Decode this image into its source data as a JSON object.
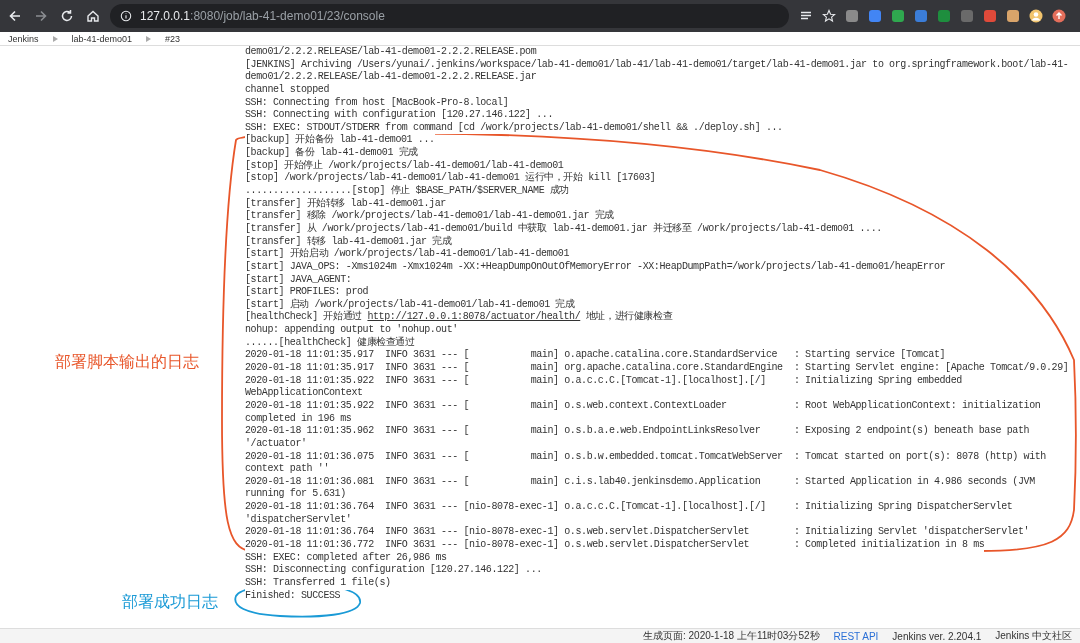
{
  "browser": {
    "url_host": "127.0.0.1",
    "url_path": ":8080/job/lab-41-demo01/23/console"
  },
  "breadcrumbs": [
    "Jenkins",
    "lab-41-demo01",
    "#23"
  ],
  "console": {
    "lines": [
      {
        "text": "demo01/2.2.2.RELEASE/lab-41-demo01-2.2.2.RELEASE.pom"
      },
      {
        "text": "[JENKINS] Archiving /Users/yunai/.jenkins/workspace/lab-41-demo01/lab-41/lab-41-demo01/target/lab-41-demo01.jar to org.springframework.boot/lab-41-"
      },
      {
        "text": "demo01/2.2.2.RELEASE/lab-41-demo01-2.2.2.RELEASE.jar"
      },
      {
        "text": "channel stopped"
      },
      {
        "text": "SSH: Connecting from host [MacBook-Pro-8.local]"
      },
      {
        "text": "SSH: Connecting with configuration [120.27.146.122] ..."
      },
      {
        "text": "SSH: EXEC: STDOUT/STDERR from command [cd /work/projects/lab-41-demo01/shell && ./deploy.sh] ..."
      },
      {
        "text": "[backup] 开始备份 lab-41-demo01 ..."
      },
      {
        "text": "[backup] 备份 lab-41-demo01 完成"
      },
      {
        "text": "[stop] 开始停止 /work/projects/lab-41-demo01/lab-41-demo01"
      },
      {
        "text": "[stop] /work/projects/lab-41-demo01/lab-41-demo01 运行中，开始 kill [17603]"
      },
      {
        "text": "...................[stop] 停止 $BASE_PATH/$SERVER_NAME 成功"
      },
      {
        "text": "[transfer] 开始转移 lab-41-demo01.jar"
      },
      {
        "text": "[transfer] 移除 /work/projects/lab-41-demo01/lab-41-demo01.jar 完成"
      },
      {
        "text": "[transfer] 从 /work/projects/lab-41-demo01/build 中获取 lab-41-demo01.jar 并迁移至 /work/projects/lab-41-demo01 ...."
      },
      {
        "text": "[transfer] 转移 lab-41-demo01.jar 完成"
      },
      {
        "text": "[start] 开始启动 /work/projects/lab-41-demo01/lab-41-demo01"
      },
      {
        "text": "[start] JAVA_OPS: -Xms1024m -Xmx1024m -XX:+HeapDumpOnOutOfMemoryError -XX:HeapDumpPath=/work/projects/lab-41-demo01/heapError"
      },
      {
        "text": "[start] JAVA_AGENT:"
      },
      {
        "text": "[start] PROFILES: prod"
      },
      {
        "text": "[start] 启动 /work/projects/lab-41-demo01/lab-41-demo01 完成"
      },
      {
        "text": "[healthCheck] 开始通过 ",
        "link": "http://127.0.0.1:8078/actuator/health/",
        "after": " 地址，进行健康检查"
      },
      {
        "text": "nohup: appending output to 'nohup.out'"
      },
      {
        "text": "......[healthCheck] 健康检查通过"
      },
      {
        "text": "2020-01-18 11:01:35.917  INFO 3631 --- [           main] o.apache.catalina.core.StandardService   : Starting service [Tomcat]"
      },
      {
        "text": "2020-01-18 11:01:35.917  INFO 3631 --- [           main] org.apache.catalina.core.StandardEngine  : Starting Servlet engine: [Apache Tomcat/9.0.29]"
      },
      {
        "text": "2020-01-18 11:01:35.922  INFO 3631 --- [           main] o.a.c.c.C.[Tomcat-1].[localhost].[/]     : Initializing Spring embedded"
      },
      {
        "text": "WebApplicationContext"
      },
      {
        "text": "2020-01-18 11:01:35.922  INFO 3631 --- [           main] o.s.web.context.ContextLoader            : Root WebApplicationContext: initialization"
      },
      {
        "text": "completed in 196 ms"
      },
      {
        "text": "2020-01-18 11:01:35.962  INFO 3631 --- [           main] o.s.b.a.e.web.EndpointLinksResolver      : Exposing 2 endpoint(s) beneath base path"
      },
      {
        "text": "'/actuator'"
      },
      {
        "text": "2020-01-18 11:01:36.075  INFO 3631 --- [           main] o.s.b.w.embedded.tomcat.TomcatWebServer  : Tomcat started on port(s): 8078 (http) with"
      },
      {
        "text": "context path ''"
      },
      {
        "text": "2020-01-18 11:01:36.081  INFO 3631 --- [           main] c.i.s.lab40.jenkinsdemo.Application      : Started Application in 4.986 seconds (JVM"
      },
      {
        "text": "running for 5.631)"
      },
      {
        "text": "2020-01-18 11:01:36.764  INFO 3631 --- [nio-8078-exec-1] o.a.c.c.C.[Tomcat-1].[localhost].[/]     : Initializing Spring DispatcherServlet"
      },
      {
        "text": "'dispatcherServlet'"
      },
      {
        "text": "2020-01-18 11:01:36.764  INFO 3631 --- [nio-8078-exec-1] o.s.web.servlet.DispatcherServlet        : Initializing Servlet 'dispatcherServlet'"
      },
      {
        "text": "2020-01-18 11:01:36.772  INFO 3631 --- [nio-8078-exec-1] o.s.web.servlet.DispatcherServlet        : Completed initialization in 8 ms"
      },
      {
        "text": "SSH: EXEC: completed after 26,986 ms"
      },
      {
        "text": "SSH: Disconnecting configuration [120.27.146.122] ..."
      },
      {
        "text": "SSH: Transferred 1 file(s)"
      },
      {
        "text": "Finished: SUCCESS"
      }
    ]
  },
  "annotations": [
    {
      "text": "部署脚本输出的日志",
      "color": "#e8562a"
    },
    {
      "text": "部署成功日志",
      "color": "#1a9ad6"
    }
  ],
  "footer": {
    "generated": "生成页面: 2020-1-18 上午11时03分52秒",
    "links": [
      "REST API",
      "Jenkins ver. 2.204.1",
      "Jenkins 中文社区"
    ]
  }
}
